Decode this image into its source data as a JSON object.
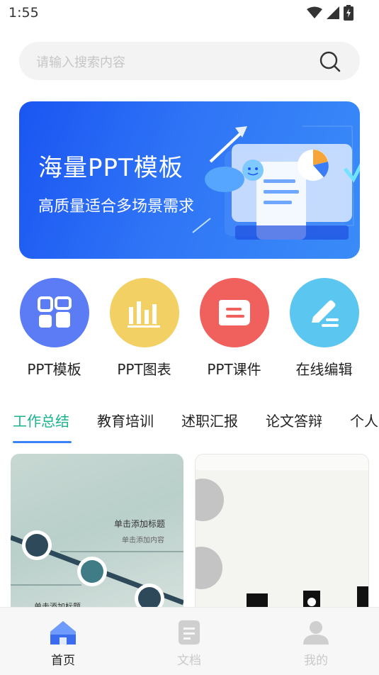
{
  "status_bar": {
    "time": "1:55",
    "icons": [
      "wifi-icon",
      "cell-signal-icon",
      "battery-charging-icon"
    ]
  },
  "search": {
    "placeholder": "请输入搜索内容",
    "icon": "search-icon"
  },
  "banner": {
    "title": "海量PPT模板",
    "subtitle": "高质量适合多场景需求",
    "colors": {
      "start": "#1a55f2",
      "end": "#3a8cf8"
    }
  },
  "quick_actions": [
    {
      "label": "PPT模板",
      "icon": "grid-icon",
      "color": "#5b7cf5"
    },
    {
      "label": "PPT图表",
      "icon": "bar-chart-icon",
      "color": "#f3d063"
    },
    {
      "label": "PPT课件",
      "icon": "document-icon",
      "color": "#f0605c"
    },
    {
      "label": "在线编辑",
      "icon": "pen-icon",
      "color": "#5bc6f0"
    }
  ],
  "tabs": [
    {
      "label": "工作总结",
      "active": true
    },
    {
      "label": "教育培训",
      "active": false
    },
    {
      "label": "述职汇报",
      "active": false
    },
    {
      "label": "论文答辩",
      "active": false
    },
    {
      "label": "个人",
      "active": false
    }
  ],
  "accent_color": "#19b38d",
  "cards": [
    {
      "title": "单击添加标题",
      "subtitle": "单击添加内容",
      "footer": "单击添加标题"
    },
    {
      "title": "",
      "subtitle": "",
      "footer": ""
    }
  ],
  "bottom_nav": [
    {
      "label": "首页",
      "icon": "home-icon",
      "active": true
    },
    {
      "label": "文档",
      "icon": "document-icon",
      "active": false
    },
    {
      "label": "我的",
      "icon": "user-icon",
      "active": false
    }
  ]
}
